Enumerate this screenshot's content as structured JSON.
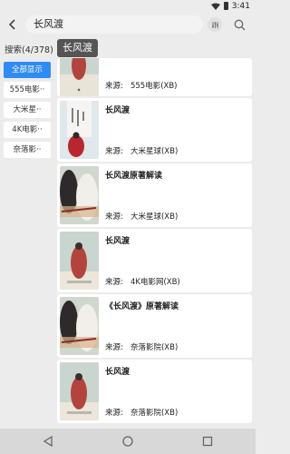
{
  "status": {
    "time": "3:41"
  },
  "search": {
    "query": "长风渡"
  },
  "header": {
    "result_count": "搜索(4/378)",
    "keyword_chip": "长风渡"
  },
  "sidebar": {
    "items": [
      {
        "label": "全部显示",
        "active": true
      },
      {
        "label": "555电影··"
      },
      {
        "label": "大米星··"
      },
      {
        "label": "4K电影··"
      },
      {
        "label": "奈落影··"
      }
    ]
  },
  "results": [
    {
      "title": "",
      "source": "来源:   555电影(XB)",
      "poster": "poster-a"
    },
    {
      "title": "长风渡",
      "source": "来源:   大米星球(XB)",
      "poster": "poster-b"
    },
    {
      "title": "长风渡原著解读",
      "source": "来源:   大米星球(XB)",
      "poster": "poster-c"
    },
    {
      "title": "长风渡",
      "source": "来源:   4K电影网(XB)",
      "poster": "poster-a"
    },
    {
      "title": "《长风渡》原著解读",
      "source": "来源:   奈落影院(XB)",
      "poster": "poster-c"
    },
    {
      "title": "长风渡",
      "source": "来源:   奈落影院(XB)",
      "poster": "poster-a"
    }
  ],
  "colors": {
    "accent": "#2f8cf4",
    "chip_bg": "#555555",
    "page_bg": "#ececec"
  }
}
